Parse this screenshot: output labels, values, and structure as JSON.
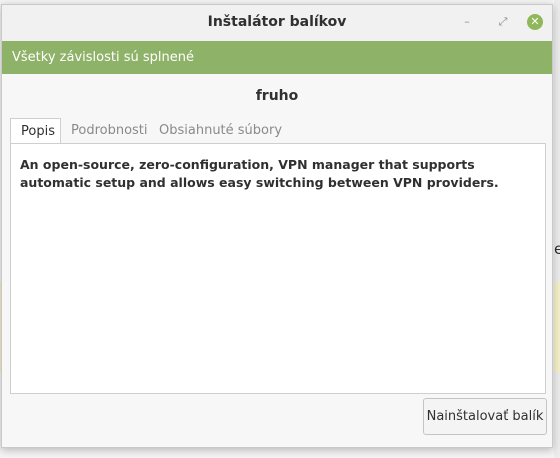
{
  "window": {
    "title": "Inštalátor balíkov",
    "minimize_glyph": "–",
    "maximize_glyph": "⤢",
    "close_glyph": "✕"
  },
  "infobar": {
    "message": "Všetky závislosti sú splnené",
    "color": "#8fb269"
  },
  "package": {
    "name": "fruho",
    "description": "An open-source, zero-configuration, VPN manager that supports automatic setup and allows easy switching between VPN providers."
  },
  "tabs": [
    {
      "label": "Popis",
      "active": true
    },
    {
      "label": "Podrobnosti",
      "active": false
    },
    {
      "label": "Obsiahnuté súbory",
      "active": false
    }
  ],
  "actions": {
    "install_label": "Nainštalovať balík"
  },
  "background": {
    "edge_text_right": "es"
  },
  "colors": {
    "accent": "#8fb85b"
  }
}
